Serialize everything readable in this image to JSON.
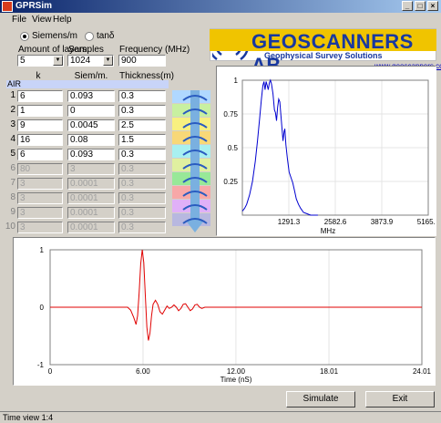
{
  "window": {
    "title": "GPRSim"
  },
  "menu": [
    "File",
    "View",
    "Help"
  ],
  "units": {
    "option1": "Siemens/m",
    "option2": "tanδ",
    "selected": "option1"
  },
  "controls": {
    "layers_label": "Amount of layers:",
    "layers_value": "5",
    "samples_label": "Samples",
    "samples_value": "1024",
    "frequency_label": "Frequency (MHz)",
    "frequency_value": "900"
  },
  "logo": {
    "name": "GEOSCANNERS AB",
    "tagline": "Geophysical Survey Solutions",
    "url": "www.geoscanners.com"
  },
  "table": {
    "headers": [
      "k",
      "Siem/m.",
      "Thickness(m)"
    ],
    "air_label": "AIR",
    "rows": [
      {
        "num": "1",
        "k": "6",
        "s": "0.093",
        "t": "0.3",
        "active": true
      },
      {
        "num": "2",
        "k": "1",
        "s": "0",
        "t": "0.3",
        "active": true
      },
      {
        "num": "3",
        "k": "9",
        "s": "0.0045",
        "t": "2.5",
        "active": true
      },
      {
        "num": "4",
        "k": "16",
        "s": "0.08",
        "t": "1.5",
        "active": true
      },
      {
        "num": "5",
        "k": "6",
        "s": "0.093",
        "t": "0.3",
        "active": true
      },
      {
        "num": "6",
        "k": "80",
        "s": "3",
        "t": "0.3",
        "active": false
      },
      {
        "num": "7",
        "k": "3",
        "s": "0.0001",
        "t": "0.3",
        "active": false
      },
      {
        "num": "8",
        "k": "3",
        "s": "0.0001",
        "t": "0.3",
        "active": false
      },
      {
        "num": "9",
        "k": "3",
        "s": "0.0001",
        "t": "0.3",
        "active": false
      },
      {
        "num": "10",
        "k": "3",
        "s": "0.0001",
        "t": "0.3",
        "active": false
      }
    ]
  },
  "ladder_colors": [
    "#b0d8ff",
    "#c8f0a0",
    "#f8f080",
    "#f8d878",
    "#a8f0f0",
    "#e0f0a0",
    "#98e898",
    "#f8a8a8",
    "#e0b0f8",
    "#b8b8e0"
  ],
  "spectrum": {
    "y_ticks": [
      "1",
      "0.75",
      "0.5",
      "0.25"
    ],
    "x_ticks": [
      "1291.3",
      "2582.6",
      "3873.9",
      "5165.1"
    ],
    "xlabel": "MHz",
    "line_color": "#0000d0",
    "points": [
      [
        0,
        0.03
      ],
      [
        60,
        0.05
      ],
      [
        120,
        0.08
      ],
      [
        200,
        0.15
      ],
      [
        280,
        0.25
      ],
      [
        360,
        0.4
      ],
      [
        420,
        0.55
      ],
      [
        480,
        0.72
      ],
      [
        530,
        0.86
      ],
      [
        570,
        0.96
      ],
      [
        600,
        0.99
      ],
      [
        630,
        0.93
      ],
      [
        660,
        0.99
      ],
      [
        690,
        0.96
      ],
      [
        720,
        0.93
      ],
      [
        750,
        0.98
      ],
      [
        780,
        1.0
      ],
      [
        810,
        0.97
      ],
      [
        850,
        0.9
      ],
      [
        890,
        0.78
      ],
      [
        920,
        0.76
      ],
      [
        950,
        0.7
      ],
      [
        980,
        0.8
      ],
      [
        1010,
        0.86
      ],
      [
        1040,
        0.84
      ],
      [
        1070,
        0.74
      ],
      [
        1100,
        0.65
      ],
      [
        1130,
        0.55
      ],
      [
        1160,
        0.62
      ],
      [
        1180,
        0.64
      ],
      [
        1210,
        0.52
      ],
      [
        1250,
        0.42
      ],
      [
        1300,
        0.32
      ],
      [
        1350,
        0.28
      ],
      [
        1400,
        0.24
      ],
      [
        1450,
        0.18
      ],
      [
        1500,
        0.12
      ],
      [
        1560,
        0.08
      ],
      [
        1620,
        0.05
      ],
      [
        1700,
        0.02
      ],
      [
        1800,
        0.01
      ],
      [
        1900,
        0.0
      ],
      [
        2100,
        0.0
      ]
    ]
  },
  "waveform": {
    "y_ticks": [
      "1",
      "0",
      "-1"
    ],
    "x_ticks": [
      "0",
      "6.00",
      "12.00",
      "18.01",
      "24.01"
    ],
    "xlabel": "Time (nS)",
    "line_color": "#e00000",
    "points": [
      [
        0,
        0
      ],
      [
        5.0,
        0
      ],
      [
        5.2,
        -0.05
      ],
      [
        5.4,
        -0.18
      ],
      [
        5.55,
        -0.3
      ],
      [
        5.65,
        -0.15
      ],
      [
        5.75,
        0.25
      ],
      [
        5.85,
        0.75
      ],
      [
        5.95,
        1.0
      ],
      [
        6.05,
        0.78
      ],
      [
        6.15,
        0.2
      ],
      [
        6.25,
        -0.35
      ],
      [
        6.35,
        -0.58
      ],
      [
        6.45,
        -0.45
      ],
      [
        6.55,
        -0.15
      ],
      [
        6.65,
        0.05
      ],
      [
        6.8,
        0.12
      ],
      [
        6.95,
        0.05
      ],
      [
        7.1,
        -0.08
      ],
      [
        7.25,
        -0.12
      ],
      [
        7.4,
        -0.05
      ],
      [
        7.55,
        0.02
      ],
      [
        7.7,
        -0.02
      ],
      [
        7.85,
        0.0
      ],
      [
        8.0,
        0.04
      ],
      [
        8.15,
        0.0
      ],
      [
        8.3,
        -0.06
      ],
      [
        8.45,
        -0.02
      ],
      [
        8.6,
        0.05
      ],
      [
        8.75,
        0.06
      ],
      [
        8.9,
        0.0
      ],
      [
        9.05,
        -0.06
      ],
      [
        9.2,
        -0.03
      ],
      [
        9.35,
        0.04
      ],
      [
        9.5,
        0.05
      ],
      [
        9.65,
        0.0
      ],
      [
        9.8,
        -0.02
      ],
      [
        10.0,
        0.0
      ],
      [
        24.01,
        0
      ]
    ]
  },
  "buttons": {
    "simulate": "Simulate",
    "exit": "Exit"
  },
  "status": "Time view 1:4"
}
